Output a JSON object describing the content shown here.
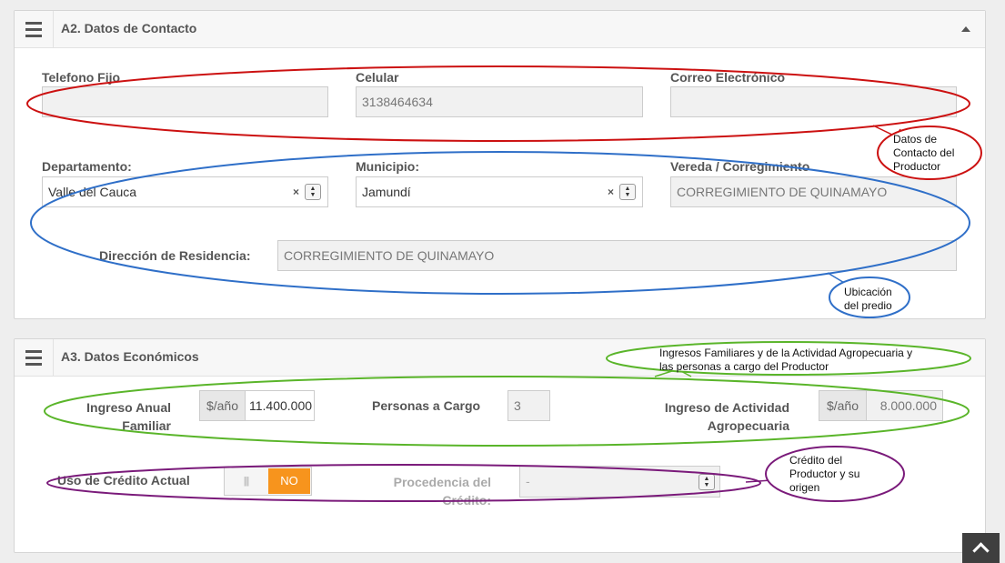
{
  "contact_section": {
    "title": "A2. Datos de Contacto",
    "phone_label": "Telefono Fijo",
    "phone_value": "",
    "mobile_label": "Celular",
    "mobile_value": "3138464634",
    "email_label": "Correo Electrónico",
    "email_value": "",
    "department_label": "Departamento:",
    "department_value": "Valle del Cauca",
    "municipality_label": "Municipio:",
    "municipality_value": "Jamundí",
    "village_label": "Vereda / Corregimiento",
    "village_value": "CORREGIMIENTO DE QUINAMAYO",
    "address_label": "Dirección de Residencia:",
    "address_value": "CORREGIMIENTO DE QUINAMAYO"
  },
  "economic_section": {
    "title": "A3. Datos Económicos",
    "annual_income_label_1": "Ingreso Anual",
    "annual_income_label_2": "Familiar",
    "annual_income_unit": "$/año",
    "annual_income_value": "11.400.000",
    "dependents_label": "Personas a Cargo",
    "dependents_value": "3",
    "agro_income_label_1": "Ingreso de Actividad",
    "agro_income_label_2": "Agropecuaria",
    "agro_income_unit": "$/año",
    "agro_income_value": "8.000.000",
    "credit_label": "Uso de Crédito Actual",
    "credit_toggle_grip": "|||",
    "credit_toggle_value": "NO",
    "credit_source_label_1": "Procedencia del",
    "credit_source_label_2": "Crédito:",
    "credit_source_value": "-"
  },
  "annotations": {
    "contact_note": [
      "Datos de",
      "Contacto del",
      "Productor"
    ],
    "location_note": [
      "Ubicación",
      "del predio"
    ],
    "income_note": [
      "Ingresos Familiares y de la Actividad Agropecuaria y",
      "las personas a cargo del Productor"
    ],
    "credit_note": [
      "Crédito del",
      "Productor y su",
      "origen"
    ],
    "colors": {
      "red": "#cc1111",
      "blue": "#2f6fc8",
      "green": "#5ab52a",
      "purple": "#7a1a7a"
    }
  },
  "icons": {
    "panel_menu": "hamburger-icon",
    "collapse": "chevron-up-icon",
    "clear": "clear-x-icon",
    "spinner": "updown-spinner-icon",
    "scroll_top": "chevron-up-icon"
  }
}
